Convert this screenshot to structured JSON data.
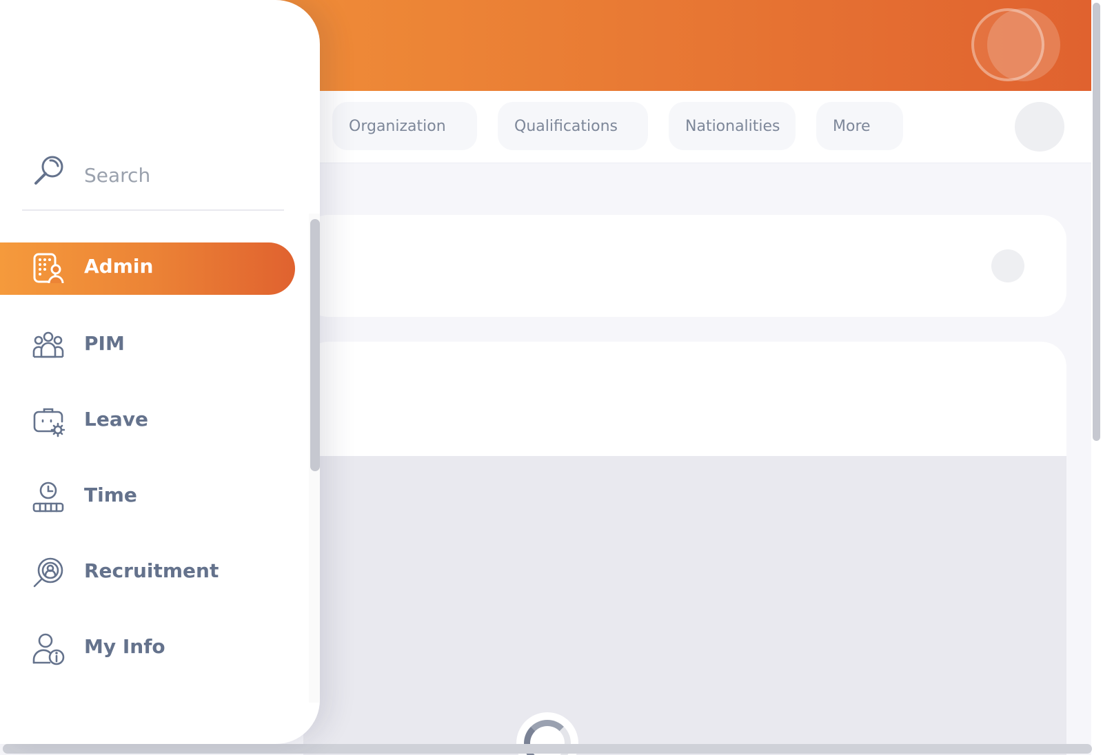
{
  "header": {
    "avatar_icon": "user-avatar-icon"
  },
  "tabs": [
    {
      "label": "Organization"
    },
    {
      "label": "Qualifications"
    },
    {
      "label": "Nationalities"
    },
    {
      "label": "More"
    }
  ],
  "sidebar": {
    "search_placeholder": "Search",
    "active_item": "Admin",
    "items": [
      {
        "label": "Admin",
        "icon": "admin-icon"
      },
      {
        "label": "PIM",
        "icon": "pim-icon"
      },
      {
        "label": "Leave",
        "icon": "leave-icon"
      },
      {
        "label": "Time",
        "icon": "time-icon"
      },
      {
        "label": "Recruitment",
        "icon": "recruitment-icon"
      },
      {
        "label": "My Info",
        "icon": "my-info-icon"
      }
    ]
  },
  "colors": {
    "accent_start": "#f59a3c",
    "accent_end": "#e0622f",
    "nav_text": "#64728c",
    "tab_text": "#7d8799"
  }
}
